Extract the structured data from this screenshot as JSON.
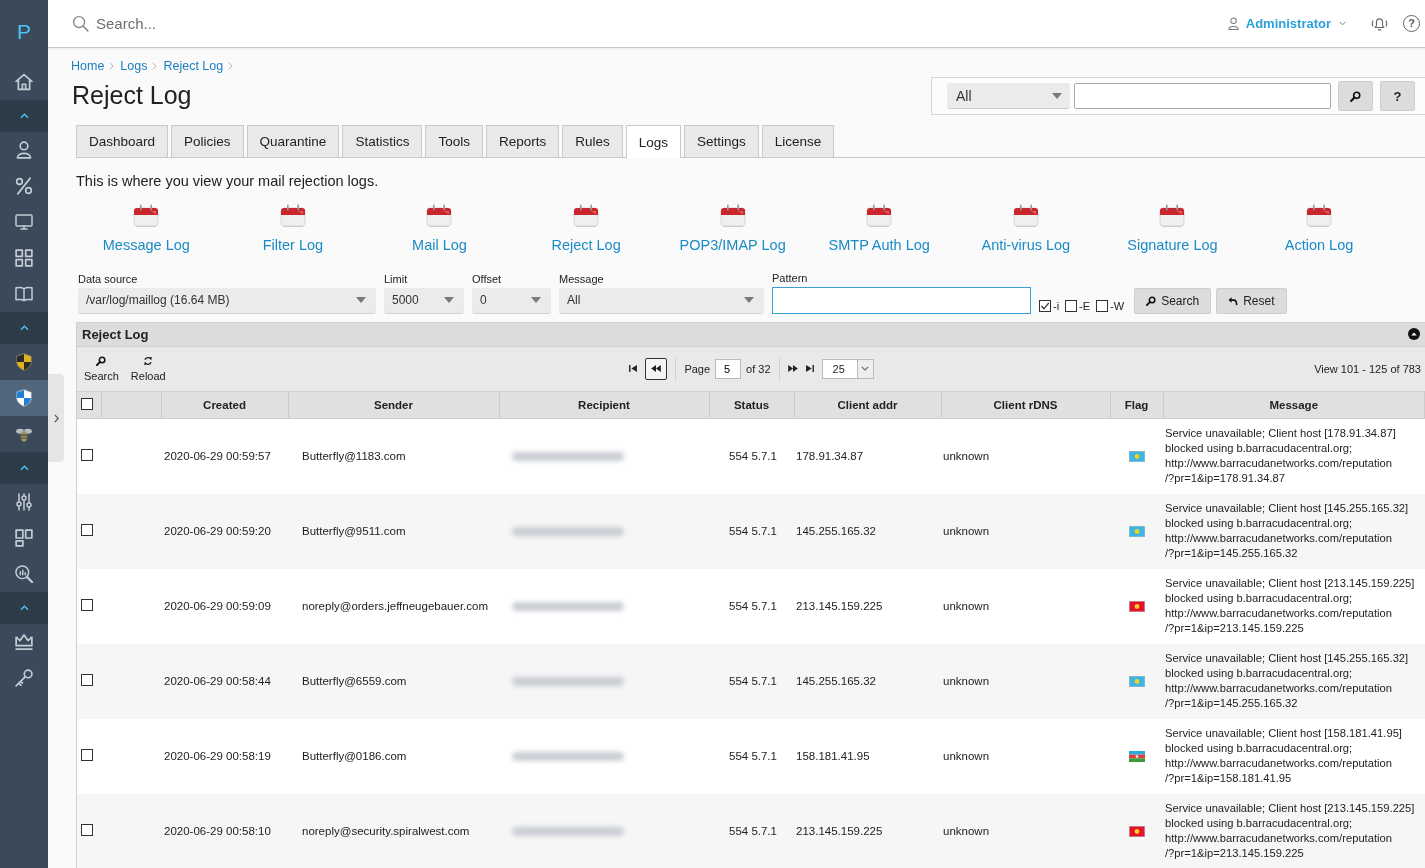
{
  "sidebar": {
    "logo": "P",
    "home": {
      "selected": false
    },
    "sections": [
      {
        "expanded": true,
        "items": [
          {
            "selected": false
          },
          {
            "selected": false
          },
          {
            "selected": false
          },
          {
            "selected": false
          },
          {
            "selected": false
          }
        ]
      },
      {
        "expanded": true,
        "items": [
          {
            "selected": false
          },
          {
            "selected": true
          },
          {
            "selected": false
          }
        ]
      },
      {
        "expanded": true,
        "items": [
          {
            "selected": false
          },
          {
            "selected": false
          },
          {
            "selected": false
          }
        ]
      },
      {
        "expanded": true,
        "items": [
          {
            "selected": false
          },
          {
            "selected": false
          }
        ]
      }
    ]
  },
  "topbar": {
    "search": {
      "placeholder": "Search..."
    },
    "user": "Administrator",
    "help": "?"
  },
  "breadcrumb": [
    "Home",
    "Logs",
    "Reject Log"
  ],
  "title": "Reject Log",
  "quick_search": {
    "scope": "All",
    "help": "?"
  },
  "tabs": [
    {
      "label": "Dashboard",
      "selected": false
    },
    {
      "label": "Policies",
      "selected": false
    },
    {
      "label": "Quarantine",
      "selected": false
    },
    {
      "label": "Statistics",
      "selected": false
    },
    {
      "label": "Tools",
      "selected": false
    },
    {
      "label": "Reports",
      "selected": false
    },
    {
      "label": "Rules",
      "selected": false
    },
    {
      "label": "Logs",
      "selected": true
    },
    {
      "label": "Settings",
      "selected": false
    },
    {
      "label": "License",
      "selected": false
    }
  ],
  "description": "This is where you view your mail rejection logs.",
  "log_links": [
    "Message Log",
    "Filter Log",
    "Mail Log",
    "Reject Log",
    "POP3/IMAP Log",
    "SMTP Auth Log",
    "Anti-virus Log",
    "Signature Log",
    "Action Log"
  ],
  "filters": {
    "data_source": {
      "label": "Data source",
      "value": "/var/log/maillog (16.64 MB)"
    },
    "limit": {
      "label": "Limit",
      "value": "5000"
    },
    "offset": {
      "label": "Offset",
      "value": "0"
    },
    "message": {
      "label": "Message",
      "value": "All"
    },
    "pattern": {
      "label": "Pattern"
    },
    "options": [
      {
        "label": "-i",
        "checked": true
      },
      {
        "label": "-E",
        "checked": false
      },
      {
        "label": "-W",
        "checked": false
      }
    ],
    "buttons": [
      "Search",
      "Reset"
    ]
  },
  "panel": {
    "title": "Reject Log",
    "expanded": true,
    "tools": [
      "Search",
      "Reload"
    ],
    "pager": {
      "page_label": "Page",
      "page": "5",
      "total": "of 32",
      "page_size": "25"
    },
    "summary": "View 101 - 125 of 783"
  },
  "table": {
    "all_checked": false,
    "columns": [
      "Created",
      "Sender",
      "Recipient",
      "Status",
      "Client addr",
      "Client rDNS",
      "Flag",
      "Message"
    ],
    "rows": [
      {
        "checked": false,
        "created": "2020-06-29 00:59:57",
        "sender": "Butterfly@1183.com",
        "recipient_redacted": true,
        "status": "554 5.7.1",
        "client_addr": "178.91.34.87",
        "client_rdns": "unknown",
        "flag": {
          "kind": "emblem",
          "color": "#3db5e6"
        },
        "message": "Service unavailable; Client host [178.91.34.87]\nblocked using b.barracudacentral.org;\nhttp://www.barracudanetworks.com/reputation\n/?pr=1&ip=178.91.34.87"
      },
      {
        "checked": false,
        "created": "2020-06-29 00:59:20",
        "sender": "Butterfly@9511.com",
        "recipient_redacted": true,
        "status": "554 5.7.1",
        "client_addr": "145.255.165.32",
        "client_rdns": "unknown",
        "flag": {
          "kind": "emblem",
          "color": "#3db5e6"
        },
        "message": "Service unavailable; Client host [145.255.165.32]\nblocked using b.barracudacentral.org;\nhttp://www.barracudanetworks.com/reputation\n/?pr=1&ip=145.255.165.32"
      },
      {
        "checked": false,
        "created": "2020-06-29 00:59:09",
        "sender": "noreply@orders.jeffneugebauer.com",
        "recipient_redacted": true,
        "status": "554 5.7.1",
        "client_addr": "213.145.159.225",
        "client_rdns": "unknown",
        "flag": {
          "kind": "emblem",
          "color": "#e8112d"
        },
        "message": "Service unavailable; Client host [213.145.159.225]\nblocked using b.barracudacentral.org;\nhttp://www.barracudanetworks.com/reputation\n/?pr=1&ip=213.145.159.225"
      },
      {
        "checked": false,
        "created": "2020-06-29 00:58:44",
        "sender": "Butterfly@6559.com",
        "recipient_redacted": true,
        "status": "554 5.7.1",
        "client_addr": "145.255.165.32",
        "client_rdns": "unknown",
        "flag": {
          "kind": "emblem",
          "color": "#3db5e6"
        },
        "message": "Service unavailable; Client host [145.255.165.32]\nblocked using b.barracudacentral.org;\nhttp://www.barracudanetworks.com/reputation\n/?pr=1&ip=145.255.165.32"
      },
      {
        "checked": false,
        "created": "2020-06-29 00:58:19",
        "sender": "Butterfly@0186.com",
        "recipient_redacted": true,
        "status": "554 5.7.1",
        "client_addr": "158.181.41.95",
        "client_rdns": "unknown",
        "flag": {
          "kind": "stripes"
        },
        "message": "Service unavailable; Client host [158.181.41.95]\nblocked using b.barracudacentral.org;\nhttp://www.barracudanetworks.com/reputation\n/?pr=1&ip=158.181.41.95"
      },
      {
        "checked": false,
        "created": "2020-06-29 00:58:10",
        "sender": "noreply@security.spiralwest.com",
        "recipient_redacted": true,
        "status": "554 5.7.1",
        "client_addr": "213.145.159.225",
        "client_rdns": "unknown",
        "flag": {
          "kind": "emblem",
          "color": "#e8112d"
        },
        "message": "Service unavailable; Client host [213.145.159.225]\nblocked using b.barracudacentral.org;\nhttp://www.barracudanetworks.com/reputation\n/?pr=1&ip=213.145.159.225"
      }
    ]
  }
}
